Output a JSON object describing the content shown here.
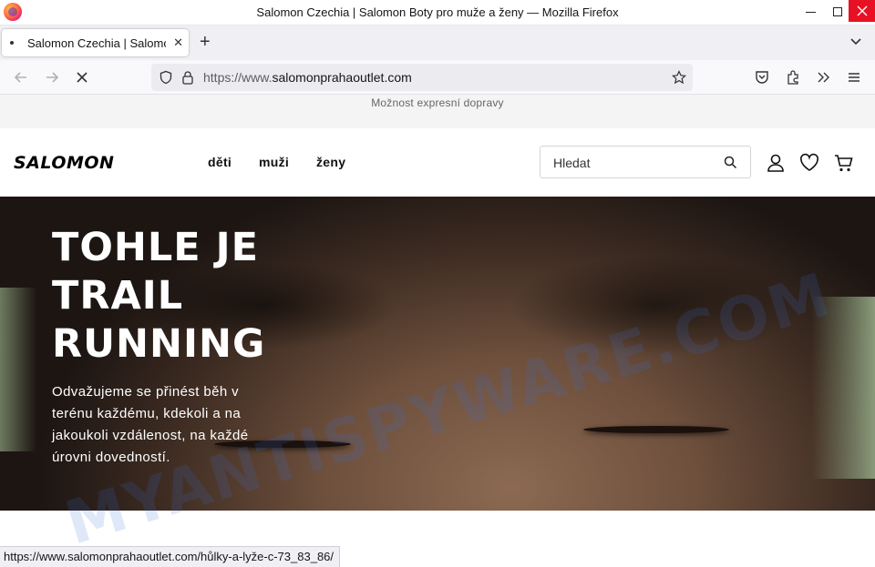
{
  "browser": {
    "window_title": "Salomon Czechia | Salomon Boty pro muže a ženy — Mozilla Firefox",
    "tab_title": "Salomon Czechia | Salomon Boty pro muže a ženy",
    "url_prefix": "https://www.",
    "url_host": "salomonprahaoutlet.com",
    "status_url": "https://www.salomonprahaoutlet.com/hůlky-a-lyže-c-73_83_86/"
  },
  "promo": {
    "text": "Možnost expresní dopravy"
  },
  "header": {
    "logo": "SALOMON",
    "nav": [
      "děti",
      "muži",
      "ženy"
    ],
    "search_placeholder": "Hledat"
  },
  "hero": {
    "title_lines": [
      "TOHLE JE",
      "TRAIL",
      "RUNNING"
    ],
    "subtitle_lines": [
      "Odvažujeme se přinést běh v",
      "terénu každému, kdekoli a na",
      "jakoukoli vzdálenost, na každé",
      "úrovni dovedností."
    ]
  },
  "watermark": {
    "text": "MYANTISPYWARE.COM"
  },
  "colors": {
    "close_button": "#e81123",
    "url_bar": "#ececf0",
    "hero_dark": "#1a1412"
  }
}
